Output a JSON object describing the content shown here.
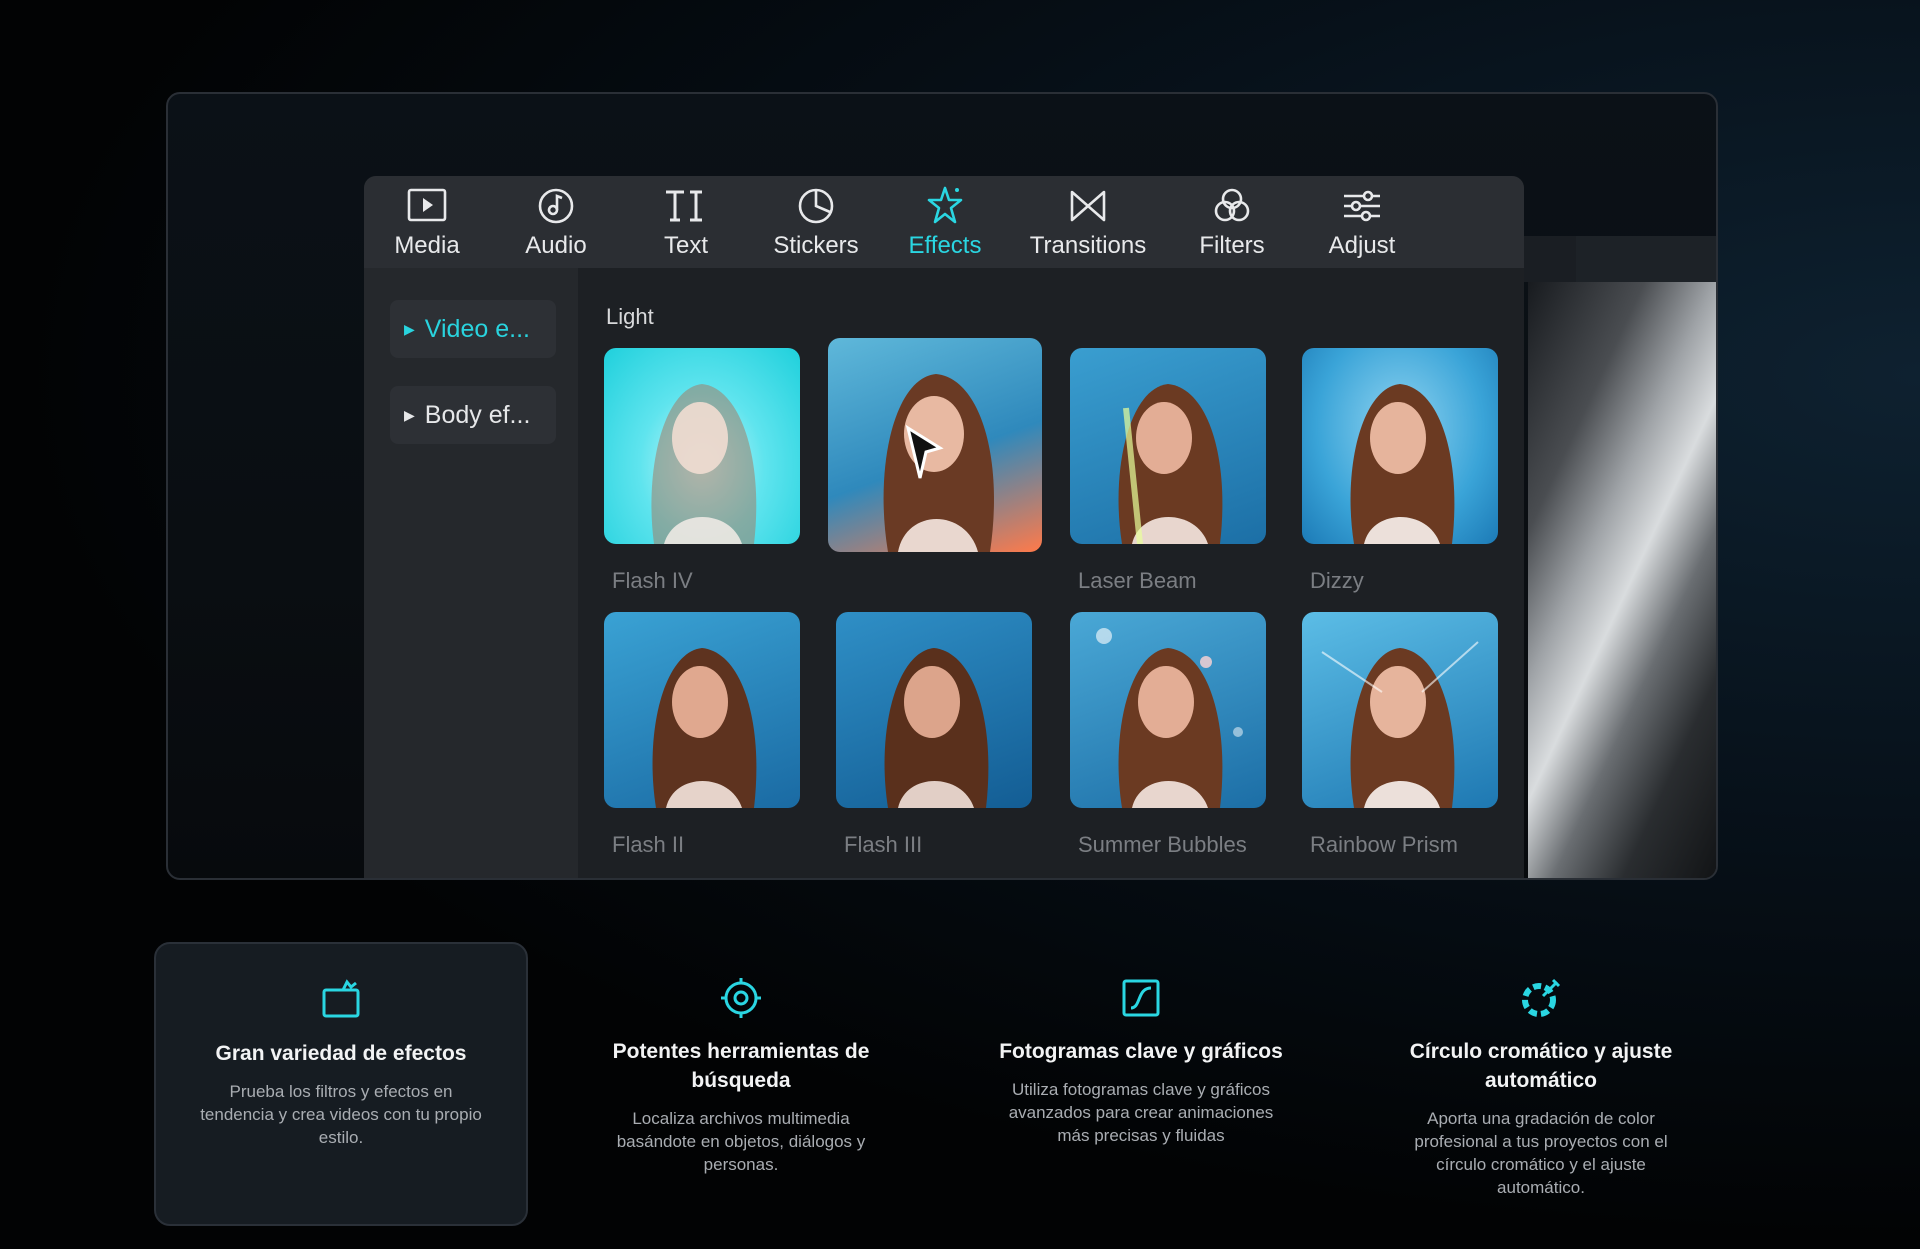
{
  "toolbar": {
    "tools": [
      {
        "label": "Media",
        "icon": "media-icon"
      },
      {
        "label": "Audio",
        "icon": "audio-icon"
      },
      {
        "label": "Text",
        "icon": "text-icon"
      },
      {
        "label": "Stickers",
        "icon": "stickers-icon"
      },
      {
        "label": "Effects",
        "icon": "effects-icon",
        "active": true
      },
      {
        "label": "Transitions",
        "icon": "transitions-icon"
      },
      {
        "label": "Filters",
        "icon": "filters-icon"
      },
      {
        "label": "Adjust",
        "icon": "adjust-icon"
      }
    ]
  },
  "sidebar": {
    "items": [
      {
        "label": "Video e...",
        "active": true
      },
      {
        "label": "Body ef..."
      }
    ]
  },
  "content": {
    "section_label": "Light",
    "effects": [
      {
        "name": "Flash IV"
      },
      {
        "name": ""
      },
      {
        "name": "Laser Beam"
      },
      {
        "name": "Dizzy"
      },
      {
        "name": "Flash II"
      },
      {
        "name": "Flash III"
      },
      {
        "name": "Summer Bubbles"
      },
      {
        "name": "Rainbow Prism"
      }
    ]
  },
  "features": [
    {
      "icon": "effects-folder-icon",
      "title": "Gran variedad de efectos",
      "description": "Prueba los filtros y efectos en tendencia y crea videos con tu propio estilo."
    },
    {
      "icon": "target-search-icon",
      "title": "Potentes herramientas de búsqueda",
      "description": "Localiza archivos multimedia basándote en objetos, diálogos y personas."
    },
    {
      "icon": "keyframe-curve-icon",
      "title": "Fotogramas clave y gráficos",
      "description": "Utiliza fotogramas clave y gráficos avanzados para crear animaciones más precisas y fluidas"
    },
    {
      "icon": "color-wheel-icon",
      "title": "Círculo cromático y ajuste automático",
      "description": "Aporta una gradación de color profesional a tus proyectos con el círculo cromático y el ajuste automático."
    }
  ],
  "colors": {
    "accent": "#2ad6e2",
    "panel": "#1e2125",
    "toolbar": "#2b2e33"
  }
}
